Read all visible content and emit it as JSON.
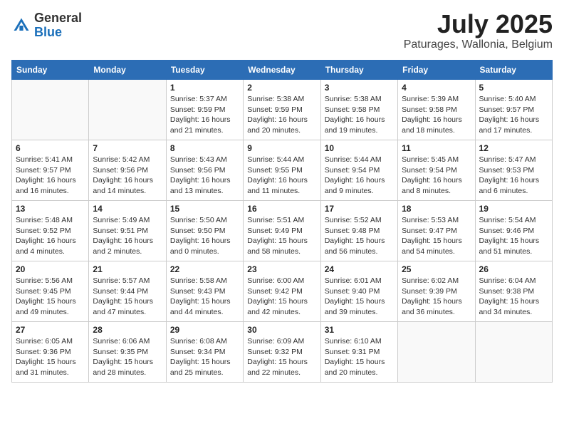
{
  "header": {
    "logo_general": "General",
    "logo_blue": "Blue",
    "month_title": "July 2025",
    "location": "Paturages, Wallonia, Belgium"
  },
  "days_of_week": [
    "Sunday",
    "Monday",
    "Tuesday",
    "Wednesday",
    "Thursday",
    "Friday",
    "Saturday"
  ],
  "weeks": [
    [
      {
        "day": "",
        "info": ""
      },
      {
        "day": "",
        "info": ""
      },
      {
        "day": "1",
        "info": "Sunrise: 5:37 AM\nSunset: 9:59 PM\nDaylight: 16 hours and 21 minutes."
      },
      {
        "day": "2",
        "info": "Sunrise: 5:38 AM\nSunset: 9:59 PM\nDaylight: 16 hours and 20 minutes."
      },
      {
        "day": "3",
        "info": "Sunrise: 5:38 AM\nSunset: 9:58 PM\nDaylight: 16 hours and 19 minutes."
      },
      {
        "day": "4",
        "info": "Sunrise: 5:39 AM\nSunset: 9:58 PM\nDaylight: 16 hours and 18 minutes."
      },
      {
        "day": "5",
        "info": "Sunrise: 5:40 AM\nSunset: 9:57 PM\nDaylight: 16 hours and 17 minutes."
      }
    ],
    [
      {
        "day": "6",
        "info": "Sunrise: 5:41 AM\nSunset: 9:57 PM\nDaylight: 16 hours and 16 minutes."
      },
      {
        "day": "7",
        "info": "Sunrise: 5:42 AM\nSunset: 9:56 PM\nDaylight: 16 hours and 14 minutes."
      },
      {
        "day": "8",
        "info": "Sunrise: 5:43 AM\nSunset: 9:56 PM\nDaylight: 16 hours and 13 minutes."
      },
      {
        "day": "9",
        "info": "Sunrise: 5:44 AM\nSunset: 9:55 PM\nDaylight: 16 hours and 11 minutes."
      },
      {
        "day": "10",
        "info": "Sunrise: 5:44 AM\nSunset: 9:54 PM\nDaylight: 16 hours and 9 minutes."
      },
      {
        "day": "11",
        "info": "Sunrise: 5:45 AM\nSunset: 9:54 PM\nDaylight: 16 hours and 8 minutes."
      },
      {
        "day": "12",
        "info": "Sunrise: 5:47 AM\nSunset: 9:53 PM\nDaylight: 16 hours and 6 minutes."
      }
    ],
    [
      {
        "day": "13",
        "info": "Sunrise: 5:48 AM\nSunset: 9:52 PM\nDaylight: 16 hours and 4 minutes."
      },
      {
        "day": "14",
        "info": "Sunrise: 5:49 AM\nSunset: 9:51 PM\nDaylight: 16 hours and 2 minutes."
      },
      {
        "day": "15",
        "info": "Sunrise: 5:50 AM\nSunset: 9:50 PM\nDaylight: 16 hours and 0 minutes."
      },
      {
        "day": "16",
        "info": "Sunrise: 5:51 AM\nSunset: 9:49 PM\nDaylight: 15 hours and 58 minutes."
      },
      {
        "day": "17",
        "info": "Sunrise: 5:52 AM\nSunset: 9:48 PM\nDaylight: 15 hours and 56 minutes."
      },
      {
        "day": "18",
        "info": "Sunrise: 5:53 AM\nSunset: 9:47 PM\nDaylight: 15 hours and 54 minutes."
      },
      {
        "day": "19",
        "info": "Sunrise: 5:54 AM\nSunset: 9:46 PM\nDaylight: 15 hours and 51 minutes."
      }
    ],
    [
      {
        "day": "20",
        "info": "Sunrise: 5:56 AM\nSunset: 9:45 PM\nDaylight: 15 hours and 49 minutes."
      },
      {
        "day": "21",
        "info": "Sunrise: 5:57 AM\nSunset: 9:44 PM\nDaylight: 15 hours and 47 minutes."
      },
      {
        "day": "22",
        "info": "Sunrise: 5:58 AM\nSunset: 9:43 PM\nDaylight: 15 hours and 44 minutes."
      },
      {
        "day": "23",
        "info": "Sunrise: 6:00 AM\nSunset: 9:42 PM\nDaylight: 15 hours and 42 minutes."
      },
      {
        "day": "24",
        "info": "Sunrise: 6:01 AM\nSunset: 9:40 PM\nDaylight: 15 hours and 39 minutes."
      },
      {
        "day": "25",
        "info": "Sunrise: 6:02 AM\nSunset: 9:39 PM\nDaylight: 15 hours and 36 minutes."
      },
      {
        "day": "26",
        "info": "Sunrise: 6:04 AM\nSunset: 9:38 PM\nDaylight: 15 hours and 34 minutes."
      }
    ],
    [
      {
        "day": "27",
        "info": "Sunrise: 6:05 AM\nSunset: 9:36 PM\nDaylight: 15 hours and 31 minutes."
      },
      {
        "day": "28",
        "info": "Sunrise: 6:06 AM\nSunset: 9:35 PM\nDaylight: 15 hours and 28 minutes."
      },
      {
        "day": "29",
        "info": "Sunrise: 6:08 AM\nSunset: 9:34 PM\nDaylight: 15 hours and 25 minutes."
      },
      {
        "day": "30",
        "info": "Sunrise: 6:09 AM\nSunset: 9:32 PM\nDaylight: 15 hours and 22 minutes."
      },
      {
        "day": "31",
        "info": "Sunrise: 6:10 AM\nSunset: 9:31 PM\nDaylight: 15 hours and 20 minutes."
      },
      {
        "day": "",
        "info": ""
      },
      {
        "day": "",
        "info": ""
      }
    ]
  ]
}
